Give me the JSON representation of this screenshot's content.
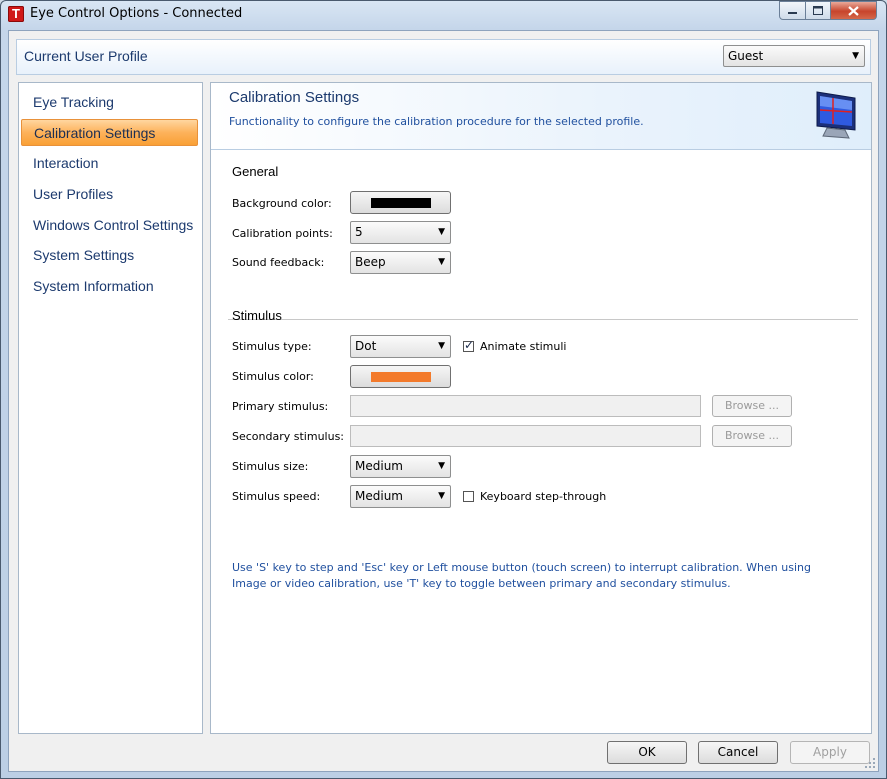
{
  "window": {
    "title": "Eye Control Options - Connected",
    "icon_letter": "T",
    "icon": "app-logo-icon"
  },
  "profile": {
    "label": "Current User Profile",
    "value": "Guest"
  },
  "sidebar": {
    "items": [
      {
        "label": "Eye Tracking"
      },
      {
        "label": "Calibration Settings",
        "active": true
      },
      {
        "label": "Interaction"
      },
      {
        "label": "User Profiles"
      },
      {
        "label": "Windows Control Settings"
      },
      {
        "label": "System Settings"
      },
      {
        "label": "System Information"
      }
    ]
  },
  "header": {
    "title": "Calibration Settings",
    "description": "Functionality to configure the calibration procedure for the selected profile.",
    "icon": "monitor-calibration-icon"
  },
  "general": {
    "title": "General",
    "background_color_label": "Background color:",
    "background_color": "#000000",
    "calibration_points_label": "Calibration points:",
    "calibration_points": "5",
    "sound_feedback_label": "Sound feedback:",
    "sound_feedback": "Beep"
  },
  "stimulus": {
    "title": "Stimulus",
    "type_label": "Stimulus type:",
    "type": "Dot",
    "animate_label": "Animate stimuli",
    "animate_checked": true,
    "color_label": "Stimulus color:",
    "color": "#f37a2b",
    "primary_label": "Primary stimulus:",
    "primary_value": "",
    "secondary_label": "Secondary stimulus:",
    "secondary_value": "",
    "browse_label": "Browse ...",
    "size_label": "Stimulus size:",
    "size": "Medium",
    "speed_label": "Stimulus speed:",
    "speed": "Medium",
    "keyboard_label": "Keyboard step-through",
    "keyboard_checked": false
  },
  "hint": "Use 'S' key to step and 'Esc' key or Left mouse button (touch screen) to interrupt calibration. When using Image or video calibration, use 'T' key to toggle between primary and secondary stimulus.",
  "buttons": {
    "ok": "OK",
    "cancel": "Cancel",
    "apply": "Apply"
  },
  "colors": {
    "accent": "#1c3a6e",
    "active_nav": "#fdb25b",
    "hint_text": "#1f4f9e"
  }
}
